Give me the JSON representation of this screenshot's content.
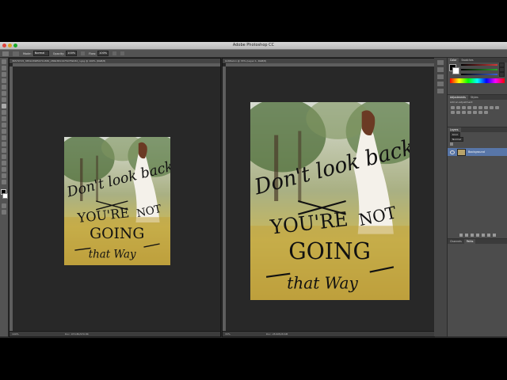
{
  "app": {
    "title": "Adobe Photoshop CC"
  },
  "colors": {
    "accent": "#5876a8",
    "workspace": "#282828",
    "panel": "#4c4c4c",
    "fill_green": "#2ba52b",
    "fill_blue": "#3a5fd0",
    "fill_red": "#d03a3a"
  },
  "options_bar": {
    "mode_label": "Mode:",
    "mode_value": "Normal",
    "opacity_label": "Opacity:",
    "opacity_value": "100%",
    "flow_label": "Flow:",
    "flow_value": "100%"
  },
  "documents": [
    {
      "tab_title": "36579715_3851239850711830_286438119750759032_n.jpg @ 100% (RGB/8)",
      "zoom": "100%",
      "doc_size": "Doc: 970.8K/970.8K"
    },
    {
      "tab_title": "Untitled-1 @ 33% (Layer 1, RGB/8)",
      "zoom": "33%",
      "doc_size": "Doc: 28.6M/28.6M"
    }
  ],
  "artwork": {
    "line1": "Don't look back",
    "line2a": "YOU'RE",
    "line2b": "NOT",
    "line3": "GOING",
    "line4": "that Way"
  },
  "panels": {
    "color_tabs": [
      "Color",
      "Swatches"
    ],
    "adjust_tabs": [
      "Adjustments",
      "Styles"
    ],
    "adjust_hint": "Add an adjustment",
    "layers_tabs": [
      "Layers"
    ],
    "layers_kind": "Kind",
    "layers_mode": "Normal",
    "layer_name": "Background",
    "bottom_tabs": [
      "Channels",
      "Paths"
    ]
  }
}
